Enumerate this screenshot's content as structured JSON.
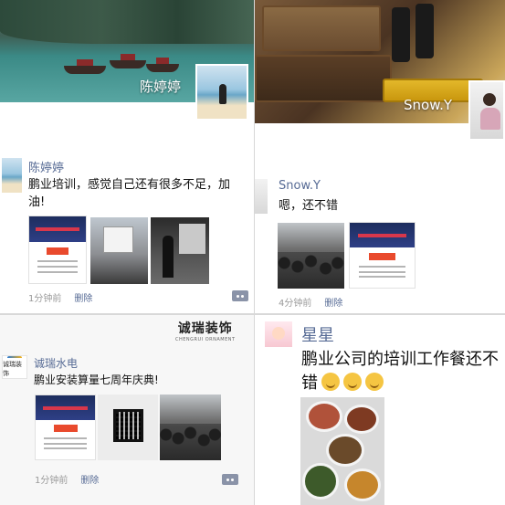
{
  "panels": [
    {
      "cover_name": "陈婷婷",
      "author": "陈婷婷",
      "text": "鹏业培训，感觉自己还有很多不足，加油!",
      "time": "1分钟前",
      "delete": "删除"
    },
    {
      "cover_name": "Snow.Y",
      "author": "Snow.Y",
      "text": "嗯，还不错",
      "time": "4分钟前",
      "delete": "删除"
    },
    {
      "brand_logo_title": "诚瑞装饰",
      "brand_logo_sub": "CHENGRUI ORNAMENT",
      "avatar_text": "诚瑞装饰",
      "author": "诚瑞水电",
      "text": "鹏业安装算量七周年庆典!",
      "time": "1分钟前",
      "delete": "删除"
    },
    {
      "author": "星星",
      "text": "鹏业公司的培训工作餐还不错"
    }
  ],
  "icons": {
    "more": "more-icon",
    "emoji": "laugh-emoji-icon"
  },
  "colors": {
    "author_blue": "#576b95",
    "meta_gray": "#9a9a9a"
  }
}
